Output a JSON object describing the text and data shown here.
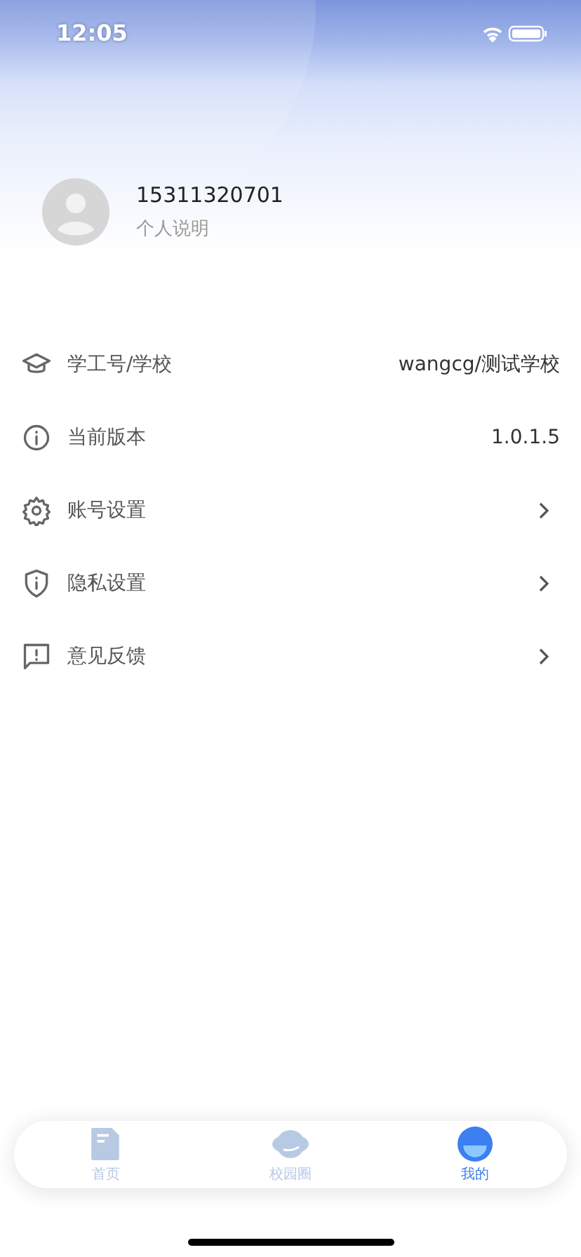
{
  "status_bar": {
    "time": "12:05"
  },
  "profile": {
    "phone": "15311320701",
    "bio": "个人说明"
  },
  "rows": [
    {
      "kind": "value",
      "label": "学工号/学校",
      "value": "wangcg/测试学校"
    },
    {
      "kind": "value",
      "label": "当前版本",
      "value": "1.0.1.5"
    },
    {
      "kind": "link",
      "label": "账号设置"
    },
    {
      "kind": "link",
      "label": "隐私设置"
    },
    {
      "kind": "link",
      "label": "意见反馈"
    }
  ],
  "tabs": [
    {
      "label": "首页",
      "selected": false
    },
    {
      "label": "校园圈",
      "selected": false
    },
    {
      "label": "我的",
      "selected": true
    }
  ]
}
